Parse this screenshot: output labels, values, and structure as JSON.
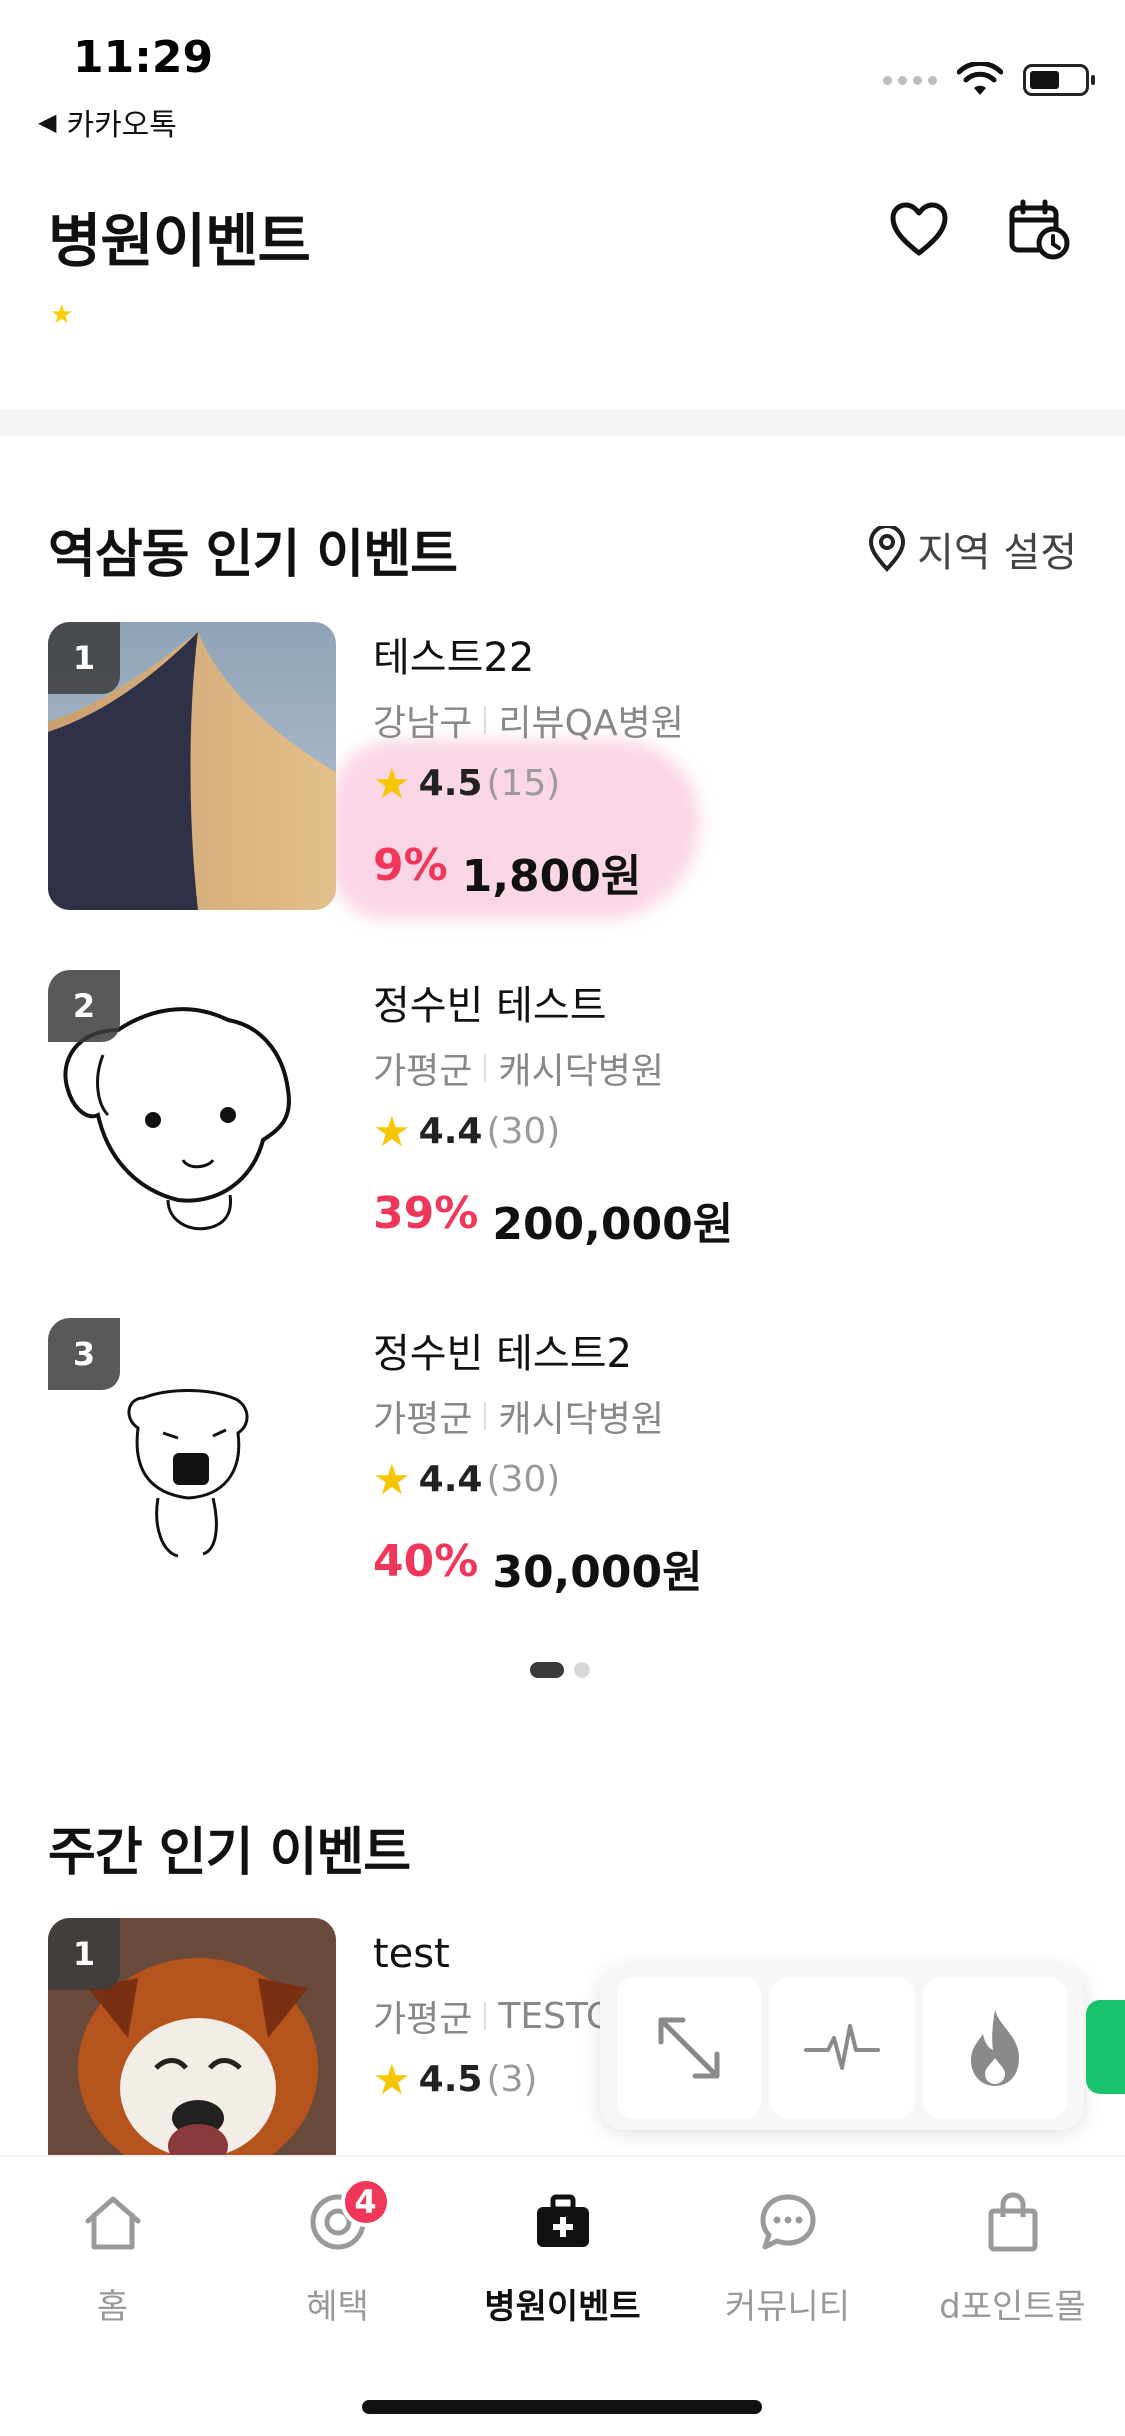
{
  "status_bar": {
    "time": "11:29",
    "back_app": "카카오톡"
  },
  "header": {
    "title": "병원이벤트"
  },
  "popular_section": {
    "title": "역삼동 인기 이벤트",
    "region_label": "지역 설정",
    "items": [
      {
        "rank": "1",
        "name": "테스트22",
        "district": "강남구",
        "hospital": "리뷰QA병원",
        "rating": "4.5",
        "reviews": "(15)",
        "discount": "9%",
        "price": "1,800원"
      },
      {
        "rank": "2",
        "name": "정수빈 테스트",
        "district": "가평군",
        "hospital": "캐시닥병원",
        "rating": "4.4",
        "reviews": "(30)",
        "discount": "39%",
        "price": "200,000원"
      },
      {
        "rank": "3",
        "name": "정수빈 테스트2",
        "district": "가평군",
        "hospital": "캐시닥병원",
        "rating": "4.4",
        "reviews": "(30)",
        "discount": "40%",
        "price": "30,000원"
      }
    ]
  },
  "weekly_section": {
    "title": "주간 인기 이벤트",
    "items": [
      {
        "rank": "1",
        "name": "test",
        "district": "가평군",
        "hospital": "TESTC",
        "rating": "4.5",
        "reviews": "(3)"
      }
    ]
  },
  "bottom_nav": {
    "items": [
      {
        "label": "홈",
        "icon": "home-icon"
      },
      {
        "label": "혜택",
        "icon": "benefit-icon",
        "badge": "4"
      },
      {
        "label": "병원이벤트",
        "icon": "medical-bag-icon",
        "active": true
      },
      {
        "label": "커뮤니티",
        "icon": "chat-icon"
      },
      {
        "label": "d포인트몰",
        "icon": "shopping-bag-icon"
      }
    ]
  },
  "colors": {
    "discount": "#f0375a",
    "star": "#f7c600",
    "accent_green": "#19c36b"
  }
}
